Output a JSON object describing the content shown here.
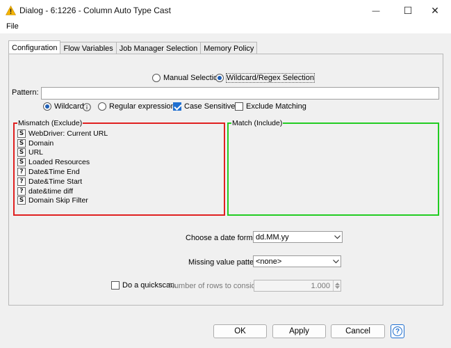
{
  "window": {
    "title": "Dialog - 6:1226 - Column Auto Type Cast",
    "minimize_glyph": "—",
    "maximize_glyph": "☐",
    "close_glyph": "✕"
  },
  "menu": {
    "file": "File"
  },
  "tabs": [
    {
      "label": "Configuration",
      "active": true
    },
    {
      "label": "Flow Variables",
      "active": false
    },
    {
      "label": "Job Manager Selection",
      "active": false
    },
    {
      "label": "Memory Policy",
      "active": false
    }
  ],
  "selection_mode": {
    "manual_label": "Manual Selection",
    "wildcard_label": "Wildcard/Regex Selection",
    "selected": "wildcard"
  },
  "pattern": {
    "label": "Pattern:",
    "value": ""
  },
  "pattern_options": {
    "wildcard_label": "Wildcard",
    "regex_label": "Regular expression",
    "selected": "wildcard",
    "case_sensitive_label": "Case Sensitive",
    "case_sensitive_checked": true,
    "exclude_matching_label": "Exclude Matching",
    "exclude_matching_checked": false
  },
  "mismatch": {
    "title": "Mismatch (Exclude)",
    "border_color": "#e02020",
    "items": [
      {
        "type": "S",
        "name": "WebDriver: Current URL"
      },
      {
        "type": "S",
        "name": "Domain"
      },
      {
        "type": "S",
        "name": "URL"
      },
      {
        "type": "S",
        "name": "Loaded Resources"
      },
      {
        "type": "?",
        "name": "Date&Time End"
      },
      {
        "type": "?",
        "name": "Date&Time Start"
      },
      {
        "type": "?",
        "name": "date&time diff"
      },
      {
        "type": "S",
        "name": "Domain Skip Filter"
      }
    ]
  },
  "match": {
    "title": "Match (Include)",
    "border_color": "#22cc22"
  },
  "date_format": {
    "label": "Choose a date format:",
    "value": "dd.MM.yy"
  },
  "missing_value": {
    "label": "Missing value pattern:",
    "value": "<none>"
  },
  "quickscan": {
    "label": "Do a quickscan.",
    "checked": false,
    "rows_label": "Number of rows to consider:",
    "rows_value": "1.000"
  },
  "buttons": {
    "ok": "OK",
    "apply": "Apply",
    "cancel": "Cancel",
    "help": "?"
  },
  "colors": {
    "accent": "#1f6fd0",
    "warning_icon": "#f5b400"
  }
}
